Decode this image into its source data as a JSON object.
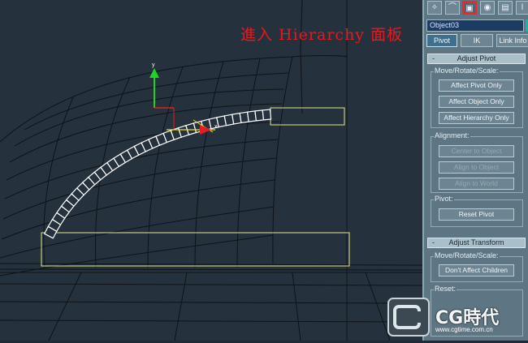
{
  "annotation": "進入 Hierarchy 面板",
  "command_panel": {
    "toolbar": [
      {
        "name": "create-tab",
        "icon": "wand-icon",
        "glyph": "✧"
      },
      {
        "name": "modify-tab",
        "icon": "arc-icon",
        "glyph": "⌒"
      },
      {
        "name": "hierarchy-tab",
        "icon": "hierarchy-icon",
        "glyph": "▣",
        "active": true
      },
      {
        "name": "motion-tab",
        "icon": "circle-icon",
        "glyph": "◉"
      },
      {
        "name": "display-tab",
        "icon": "display-icon",
        "glyph": "▤"
      },
      {
        "name": "utilities-tab",
        "icon": "hammer-icon",
        "glyph": "ǀ"
      }
    ],
    "object_name": "Object03",
    "object_color": "#1bb3a6",
    "subtabs": [
      "Pivot",
      "IK",
      "Link Info"
    ],
    "active_subtab": "Pivot",
    "adjust_pivot": {
      "title": "Adjust Pivot",
      "collapse_sign": "-",
      "move_rotate_scale_label": "Move/Rotate/Scale:",
      "affect_pivot_only": "Affect Pivot Only",
      "affect_object_only": "Affect Object Only",
      "affect_hierarchy_only": "Affect Hierarchy Only",
      "alignment_label": "Alignment:",
      "center_to_object": "Center to Object",
      "align_to_object": "Align to Object",
      "align_to_world": "Align to World",
      "pivot_label": "Pivot:",
      "reset_pivot": "Reset Pivot"
    },
    "adjust_transform": {
      "title": "Adjust Transform",
      "collapse_sign": "-",
      "move_rotate_scale_label": "Move/Rotate/Scale:",
      "dont_affect_children": "Don't Affect Children",
      "reset_label": "Reset:"
    }
  },
  "watermark": {
    "text": "CG時代",
    "url": "www.cgtime.com.cn"
  },
  "gizmo": {
    "y_label": "y",
    "x_label": "x"
  }
}
